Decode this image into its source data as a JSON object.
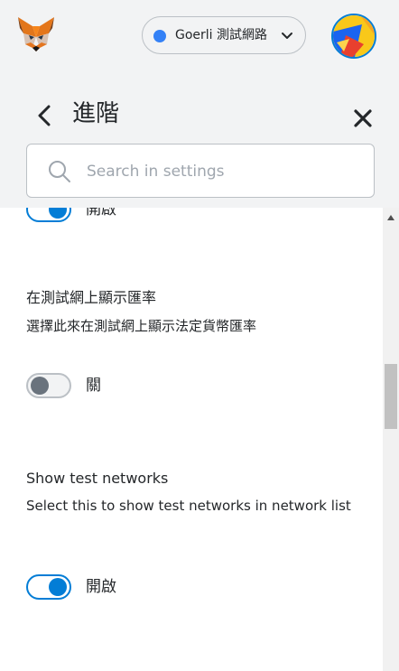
{
  "header": {
    "logo_icon": "metamask-fox-icon",
    "network": {
      "label": "Goerli 測試網路",
      "dot_color": "#3481f6",
      "chevron_icon": "chevron-down-icon"
    },
    "avatar_icon": "account-identicon"
  },
  "page": {
    "back_icon": "chevron-left-icon",
    "title": "進階",
    "close_icon": "close-icon"
  },
  "search": {
    "icon": "search-icon",
    "placeholder": "Search in settings",
    "value": ""
  },
  "settings": [
    {
      "toggle_state": "on",
      "toggle_label": "開啟"
    },
    {
      "title": "在測試網上顯示匯率",
      "description": "選擇此來在測試網上顯示法定貨幣匯率",
      "toggle_state": "off",
      "toggle_label": "關"
    },
    {
      "title": "Show test networks",
      "description": "Select this to show test networks in network list",
      "toggle_state": "on",
      "toggle_label": "開啟"
    }
  ],
  "colors": {
    "accent": "#037dd6",
    "header_bg": "#f2f3f4",
    "text": "#24272a"
  }
}
